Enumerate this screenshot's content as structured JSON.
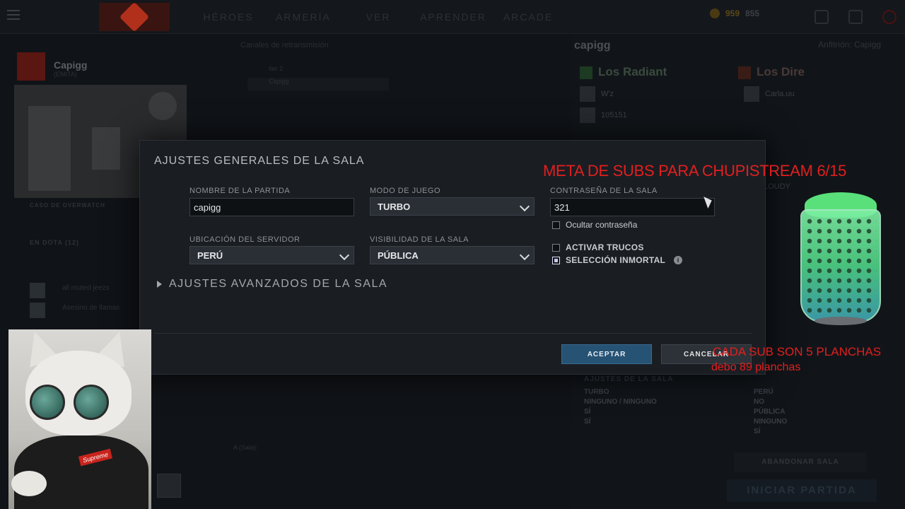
{
  "topbar": {
    "nav": [
      "HÉROES",
      "ARMERÍA",
      "VER",
      "APRENDER",
      "ARCADE"
    ],
    "currency": {
      "gold": "959",
      "other": "855"
    }
  },
  "left": {
    "profile_name": "Capigg",
    "profile_tag": "(EMITA)",
    "overwatch_label": "CASO DE OVERWATCH",
    "friends_title": "EN DOTA (12)",
    "friends": [
      "all muted jeezs",
      "Asesino de llamas"
    ]
  },
  "channels": {
    "title": "Canales de retransmisión",
    "rows": [
      "tier 2",
      "Capigg"
    ]
  },
  "lobby": {
    "name": "capigg",
    "host": "Anfitrión: Capigg",
    "radiant": "Los Radiant",
    "dire": "Los Dire",
    "radiant_players": [
      "W'z",
      "105151"
    ],
    "dire_players": [
      "Carla.uu"
    ],
    "dire_extra": "LOUDY",
    "info_title": "AJUSTES DE LA SALA",
    "info_left": [
      "TURBO",
      "NINGUNO / NINGUNO",
      "SÍ",
      "SÍ"
    ],
    "info_right": [
      "PERÚ",
      "NO",
      "PÚBLICA",
      "NINGUNO",
      "SÍ"
    ],
    "abandon": "ABANDONAR SALA",
    "start": "INICIAR PARTIDA",
    "chat_prefix": "A (Sala):"
  },
  "modal": {
    "title": "AJUSTES GENERALES DE LA SALA",
    "game_name_label": "NOMBRE DE LA PARTIDA",
    "game_name_value": "capigg",
    "game_mode_label": "MODO DE JUEGO",
    "game_mode_value": "TURBO",
    "password_label": "CONTRASEÑA DE LA SALA",
    "password_value": "321",
    "hide_password": "Ocultar contraseña",
    "server_label": "UBICACIÓN DEL SERVIDOR",
    "server_value": "PERÚ",
    "visibility_label": "VISIBILIDAD DE LA SALA",
    "visibility_value": "PÚBLICA",
    "cheats": "ACTIVAR TRUCOS",
    "immortal_pick": "SELECCIÓN INMORTAL",
    "advanced": "AJUSTES AVANZADOS DE LA SALA",
    "accept": "ACEPTAR",
    "cancel": "CANCELAR"
  },
  "overlay": {
    "goal": "META DE SUBS PARA CHUPISTREAM 6/15",
    "each_sub": "CADA SUB SON 5 PLANCHAS",
    "debt": "debo 89 planchas",
    "supreme": "Supreme"
  }
}
